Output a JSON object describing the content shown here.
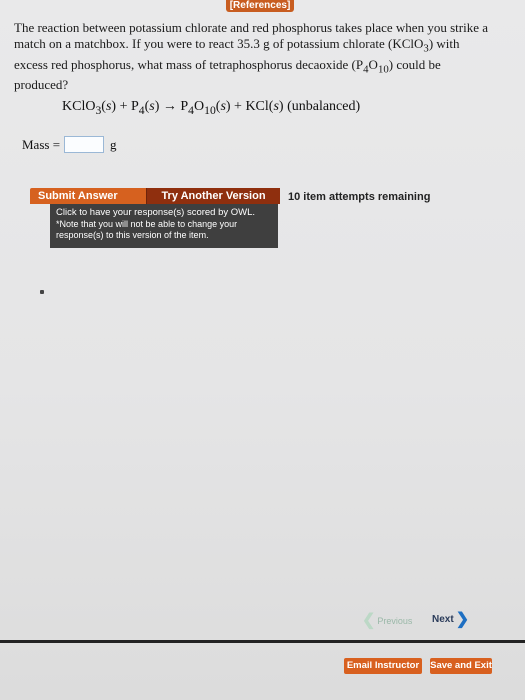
{
  "header": {
    "references_label": "[References]"
  },
  "question": {
    "text_part1": "The reaction between potassium chlorate and red phosphorus takes place when you strike a match on a matchbox. If you were to react 35.3 g of potassium chlorate (",
    "text_part2": ") with excess red phosphorus, what mass of tetraphosphorus decaoxide (",
    "text_part3": ") could be produced?"
  },
  "equation": {
    "note": "(unbalanced)"
  },
  "answer": {
    "label": "Mass =",
    "value": "",
    "unit": "g"
  },
  "actions": {
    "submit_label": "Submit Answer",
    "try_another_label": "Try Another Version",
    "attempts_text": "10 item attempts remaining",
    "tooltip_line1": "Click to have your response(s) scored by OWL.",
    "tooltip_line2": "*Note that you will not be able to change your response(s) to this version of the item."
  },
  "navigation": {
    "previous_label": "Previous",
    "next_label": "Next"
  },
  "footer": {
    "email_label": "Email Instructor",
    "save_label": "Save and Exit"
  },
  "colors": {
    "accent": "#d6611f",
    "dark_accent": "#8f2f0e",
    "tooltip_bg": "#3f3f3f",
    "next_arrow": "#1e6fc2"
  },
  "icons": {
    "previous": "chevron-left-icon",
    "next": "chevron-right-icon"
  }
}
